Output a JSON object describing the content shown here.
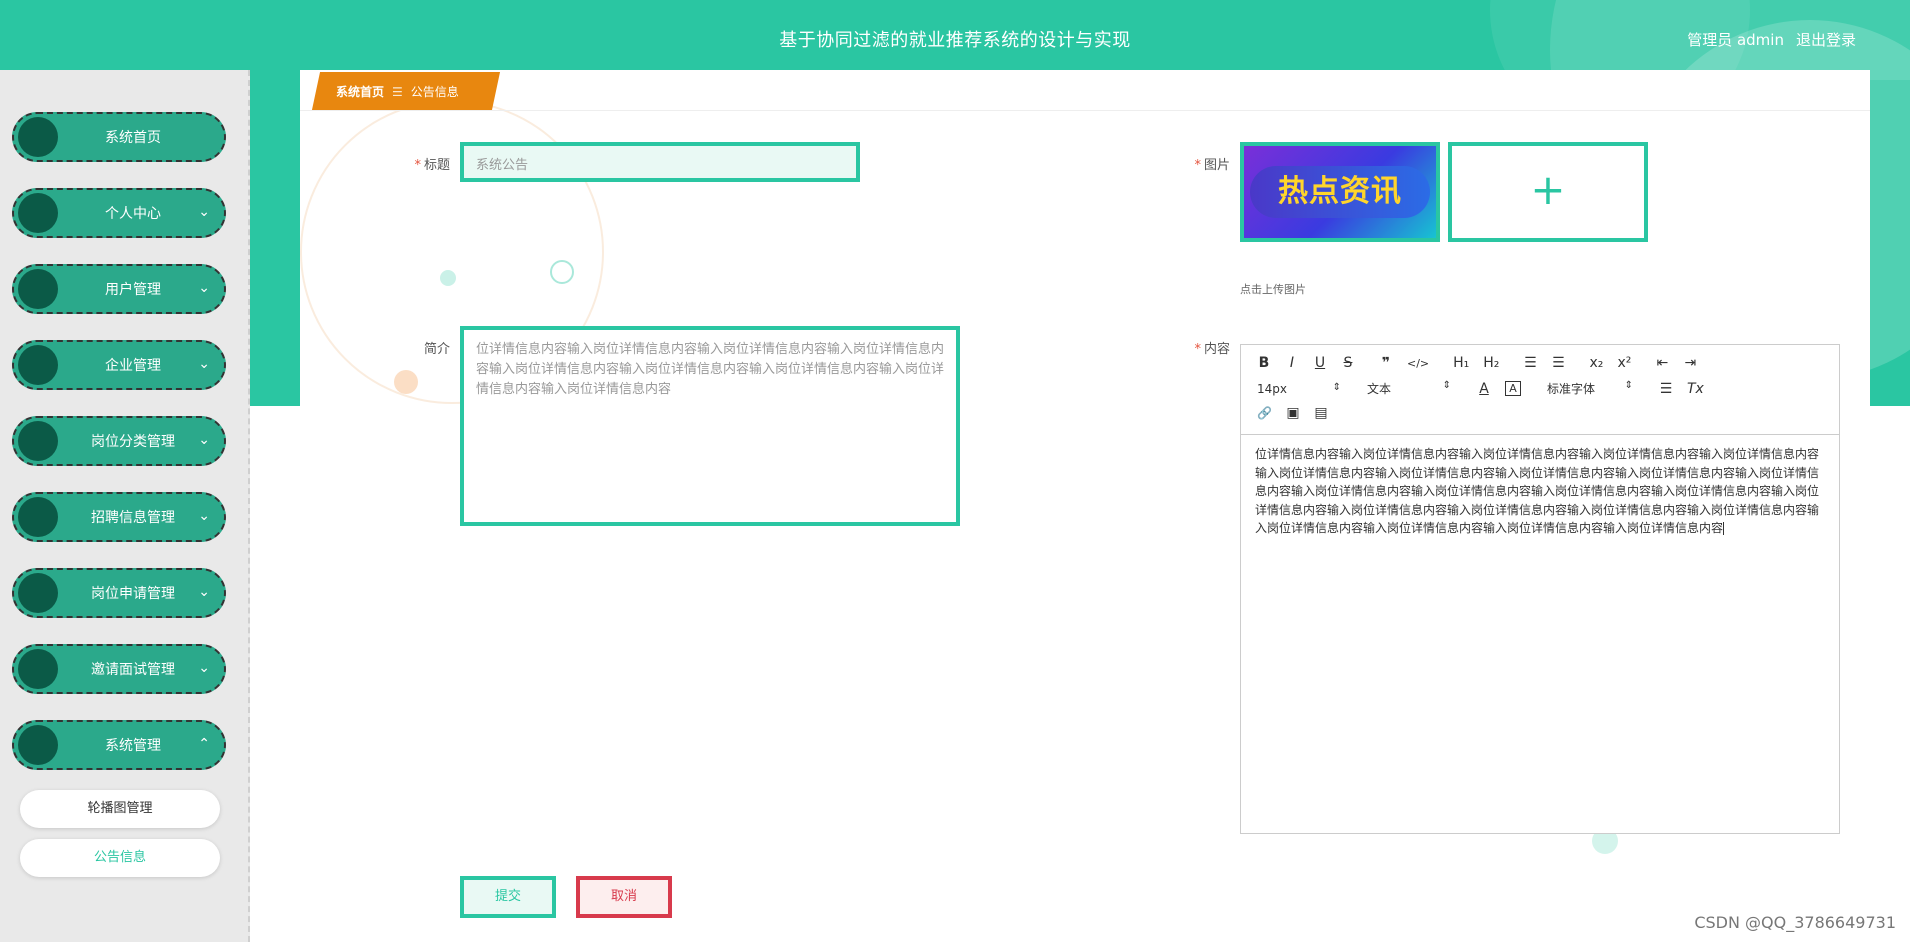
{
  "header": {
    "title": "基于协同过滤的就业推荐系统的设计与实现",
    "user": "管理员 admin",
    "logout": "退出登录"
  },
  "breadcrumb": {
    "home": "系统首页",
    "sep": "☰",
    "current": "公告信息"
  },
  "sidebar": {
    "items": [
      {
        "label": "系统首页",
        "chevron": ""
      },
      {
        "label": "个人中心",
        "chevron": "⌄"
      },
      {
        "label": "用户管理",
        "chevron": "⌄"
      },
      {
        "label": "企业管理",
        "chevron": "⌄"
      },
      {
        "label": "岗位分类管理",
        "chevron": "⌄"
      },
      {
        "label": "招聘信息管理",
        "chevron": "⌄"
      },
      {
        "label": "岗位申请管理",
        "chevron": "⌄"
      },
      {
        "label": "邀请面试管理",
        "chevron": "⌄"
      },
      {
        "label": "系统管理",
        "chevron": "⌃"
      }
    ],
    "subitems": [
      {
        "label": "轮播图管理",
        "active": false
      },
      {
        "label": "公告信息",
        "active": true
      }
    ]
  },
  "form": {
    "required_mark": "*",
    "title_label": "标题",
    "title_value": "系统公告",
    "image_label": "图片",
    "image_text": "热点资讯",
    "add_symbol": "+",
    "upload_hint": "点击上传图片",
    "intro_label": "简介",
    "intro_value": "位详情信息内容输入岗位详情信息内容输入岗位详情信息内容输入岗位详情信息内容输入岗位详情信息内容输入岗位详情信息内容输入岗位详情信息内容输入岗位详情信息内容输入岗位详情信息内容",
    "content_label": "内容",
    "content_value": "位详情信息内容输入岗位详情信息内容输入岗位详情信息内容输入岗位详情信息内容输入岗位详情信息内容输入岗位详情信息内容输入岗位详情信息内容输入岗位详情信息内容输入岗位详情信息内容输入岗位详情信息内容输入岗位详情信息内容输入岗位详情信息内容输入岗位详情信息内容输入岗位详情信息内容输入岗位详情信息内容输入岗位详情信息内容输入岗位详情信息内容输入岗位详情信息内容输入岗位详情信息内容输入岗位详情信息内容输入岗位详情信息内容输入岗位详情信息内容输入岗位详情信息内容",
    "submit": "提交",
    "cancel": "取消"
  },
  "editor": {
    "bold": "B",
    "italic": "I",
    "underline": "U",
    "strike": "S",
    "quote": "❞",
    "code": "</>",
    "h1": "H₁",
    "h2": "H₂",
    "ordered_list": "☰",
    "bullet_list": "☰",
    "subscript": "x₂",
    "superscript": "x²",
    "outdent": "⇤",
    "indent": "⇥",
    "font_size": "14px",
    "paragraph": "文本",
    "font_color": "A",
    "bg_color": "A",
    "font_family": "标准字体",
    "align": "☰",
    "clear_format": "Tx",
    "link": "🔗",
    "image": "▣",
    "video": "▤"
  },
  "watermark": "CSDN @QQ_3786649731",
  "colors": {
    "primary": "#2ac6a2",
    "dark": "#0b5a47",
    "breadcrumb": "#e8870f",
    "cancel": "#d83a4c"
  }
}
